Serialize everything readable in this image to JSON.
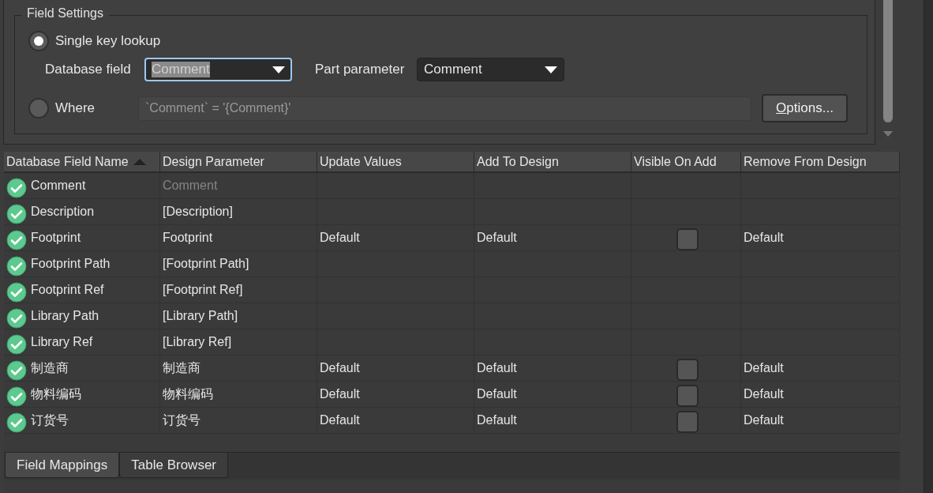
{
  "field_settings": {
    "title": "Field Settings",
    "modes": [
      {
        "label": "Single key lookup",
        "selected": true
      },
      {
        "label": "Where",
        "selected": false
      }
    ],
    "database_field": {
      "label": "Database field",
      "value": "Comment",
      "focused": true
    },
    "part_parameter": {
      "label": "Part parameter",
      "value": "Comment"
    },
    "where_clause": {
      "value": "`Comment` = '{Comment}'",
      "disabled": true
    },
    "options_button": "Options..."
  },
  "table": {
    "columns": [
      {
        "label": "Database Field Name",
        "sorted_ascending": true
      },
      {
        "label": "Design Parameter",
        "sorted_ascending": false
      },
      {
        "label": "Update Values",
        "sorted_ascending": false
      },
      {
        "label": "Add To Design",
        "sorted_ascending": false
      },
      {
        "label": "Visible On Add",
        "sorted_ascending": false
      },
      {
        "label": "Remove From Design",
        "sorted_ascending": false
      }
    ],
    "rows": [
      {
        "field": "Comment",
        "parameter": "Comment",
        "parameter_dimmed": true
      },
      {
        "field": "Description",
        "parameter": "[Description]",
        "parameter_dimmed": false
      },
      {
        "field": "Footprint",
        "parameter": "Footprint",
        "parameter_dimmed": false,
        "update_values": "Default",
        "add_to_design": "Default",
        "visible_on_add_checked": false,
        "remove_from_design": "Default"
      },
      {
        "field": "Footprint Path",
        "parameter": "[Footprint Path]",
        "parameter_dimmed": false
      },
      {
        "field": "Footprint Ref",
        "parameter": "[Footprint Ref]",
        "parameter_dimmed": false
      },
      {
        "field": "Library Path",
        "parameter": "[Library Path]",
        "parameter_dimmed": false
      },
      {
        "field": "Library Ref",
        "parameter": "[Library Ref]",
        "parameter_dimmed": false
      },
      {
        "field": "制造商",
        "parameter": "制造商",
        "parameter_dimmed": false,
        "update_values": "Default",
        "add_to_design": "Default",
        "visible_on_add_checked": false,
        "remove_from_design": "Default"
      },
      {
        "field": "物料编码",
        "parameter": "物料编码",
        "parameter_dimmed": false,
        "update_values": "Default",
        "add_to_design": "Default",
        "visible_on_add_checked": false,
        "remove_from_design": "Default"
      },
      {
        "field": "订货号",
        "parameter": "订货号",
        "parameter_dimmed": false,
        "update_values": "Default",
        "add_to_design": "Default",
        "visible_on_add_checked": false,
        "remove_from_design": "Default"
      }
    ]
  },
  "tabs": [
    {
      "label": "Field Mappings",
      "selected": true
    },
    {
      "label": "Table Browser",
      "selected": false
    }
  ]
}
